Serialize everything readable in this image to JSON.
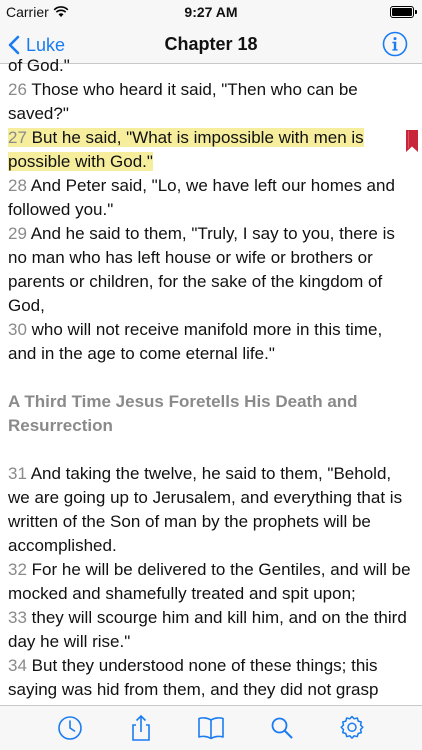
{
  "status_bar": {
    "carrier": "Carrier",
    "time": "9:27 AM"
  },
  "nav": {
    "back_label": "Luke",
    "title": "Chapter 18",
    "info_icon": "info-icon"
  },
  "colors": {
    "accent": "#1a7cf2",
    "highlight": "#f6ee9c",
    "verse_number": "#8a8a8a",
    "bookmark": "#c8253a"
  },
  "passage": {
    "top_fragment": "of God.\"",
    "verses": [
      {
        "num": "26",
        "text": " Those who heard it said, \"Then who can be saved?\""
      },
      {
        "num": "27",
        "text": " But he said, \"What is impossible with men is possible with God.\"",
        "highlighted": true,
        "bookmarked": true
      },
      {
        "num": "28",
        "text": " And Peter said, \"Lo, we have left our homes and followed you.\""
      },
      {
        "num": "29",
        "text": " And he said to them, \"Truly, I say to you, there is no man who has left house or wife or brothers or parents or children, for the sake of the kingdom of God,"
      },
      {
        "num": "30",
        "text": " who will not receive manifold more in this time, and in the age to come eternal life.\""
      }
    ],
    "section_heading": "A Third Time Jesus Foretells His Death and Resurrection",
    "verses_after": [
      {
        "num": "31",
        "text": " And taking the twelve, he said to them, \"Behold, we are going up to Jerusalem, and everything that is written of the Son of man by the prophets will be accomplished."
      },
      {
        "num": "32",
        "text": " For he will be delivered to the Gentiles, and will be mocked and shamefully treated and spit upon;"
      },
      {
        "num": "33",
        "text": " they will scourge him and kill him, and on the third day he will rise.\""
      },
      {
        "num": "34",
        "text": " But they understood none of these things; this saying was hid from them, and they did not grasp what was said."
      }
    ]
  },
  "toolbar": {
    "items": [
      "history-icon",
      "share-icon",
      "book-icon",
      "search-icon",
      "settings-icon"
    ]
  }
}
